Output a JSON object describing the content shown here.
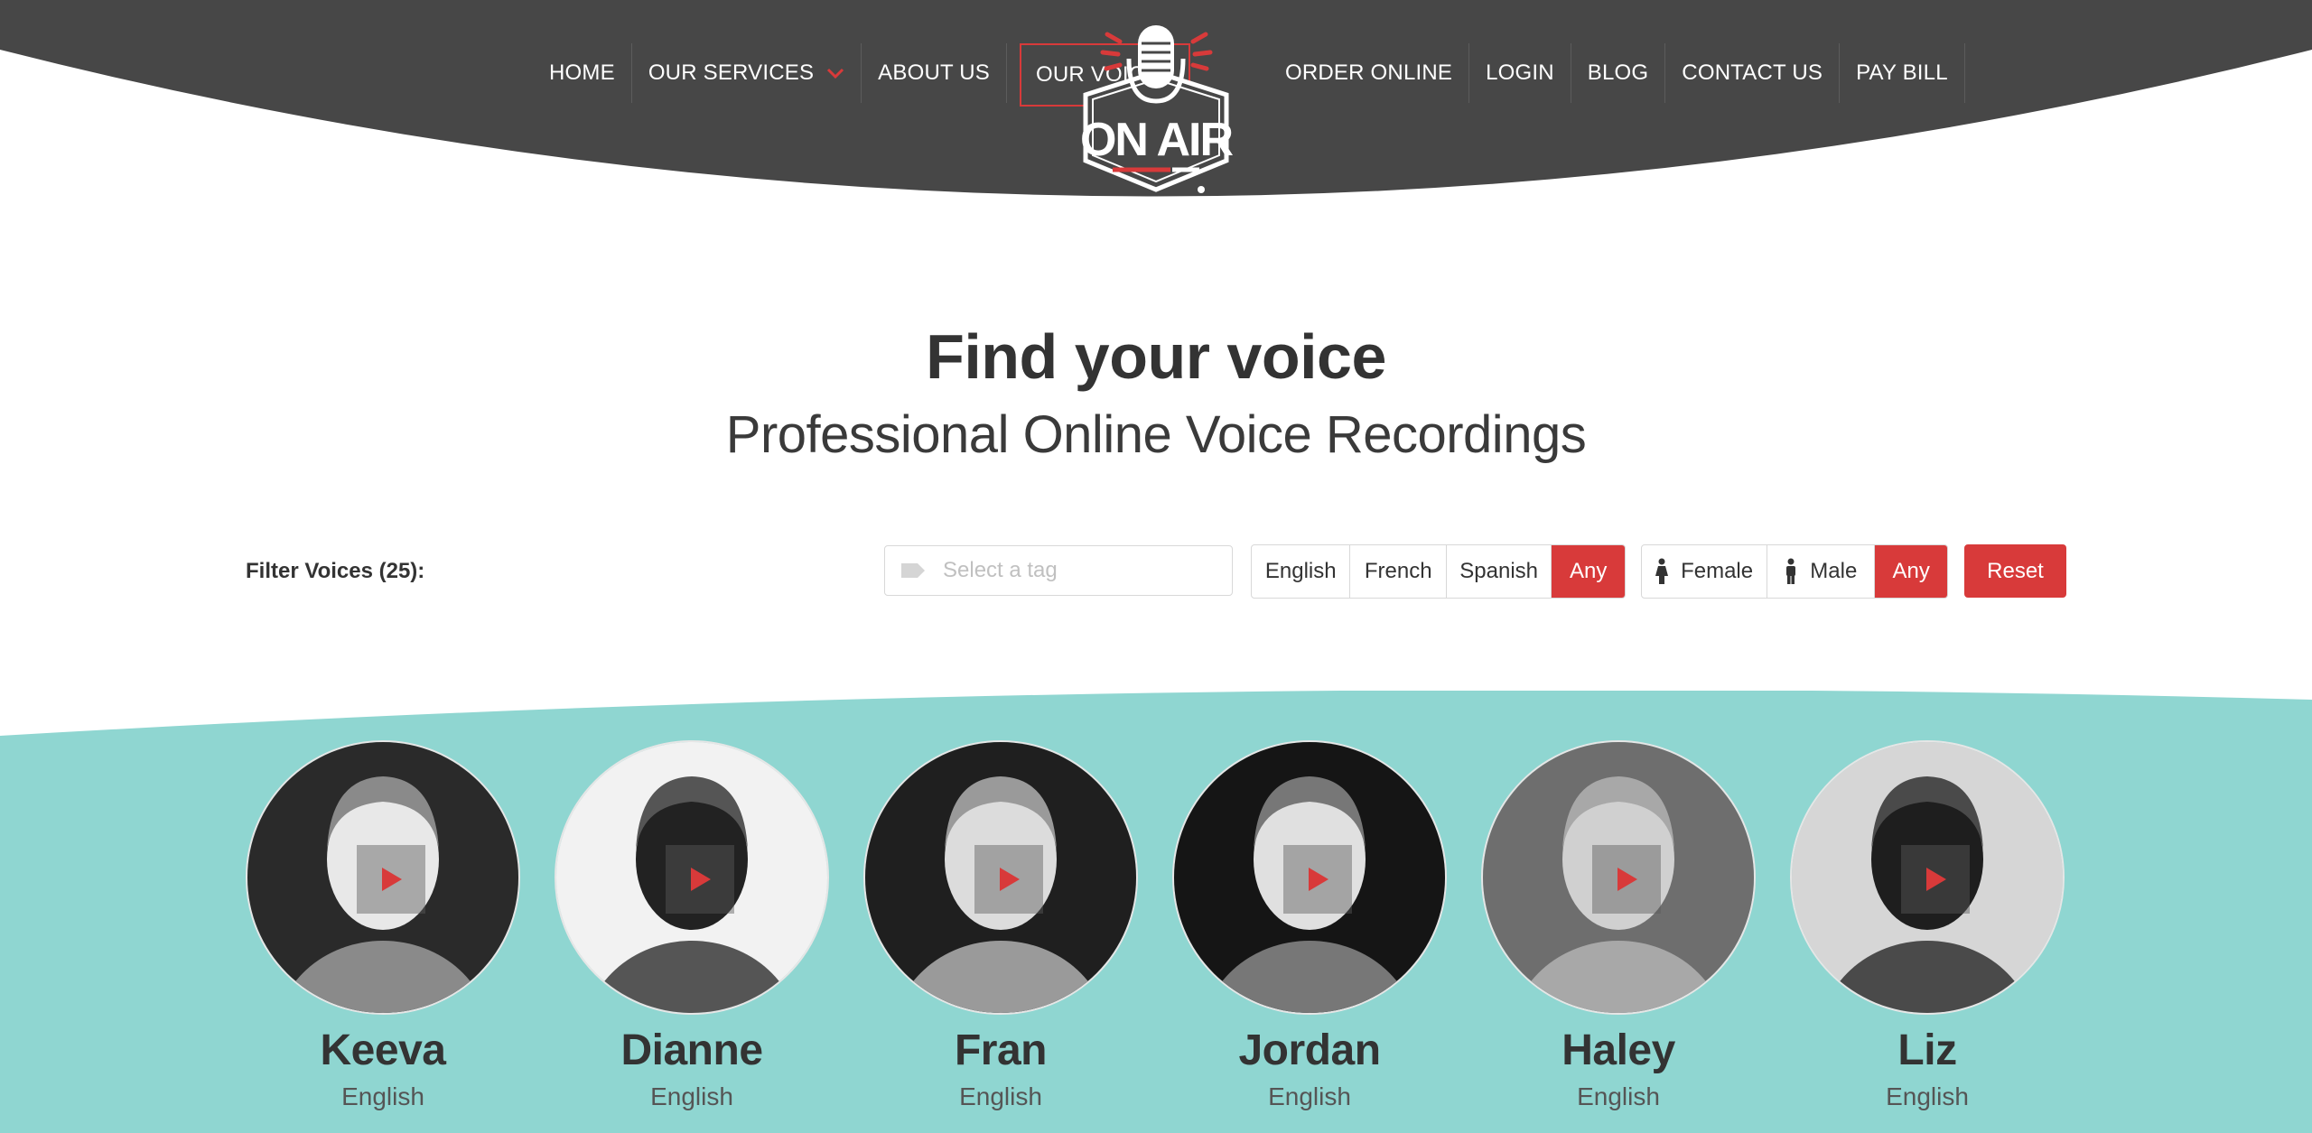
{
  "colors": {
    "header": "#474747",
    "accent": "#d83a3a",
    "teal": "#8fd6d1",
    "text": "#333333"
  },
  "nav": {
    "left": [
      {
        "label": "HOME"
      },
      {
        "label": "OUR SERVICES",
        "has_dropdown": true,
        "icon": "chevron-down-icon"
      },
      {
        "label": "ABOUT US"
      },
      {
        "label": "OUR VOICES",
        "active": true
      }
    ],
    "right": [
      {
        "label": "ORDER ONLINE"
      },
      {
        "label": "LOGIN"
      },
      {
        "label": "BLOG"
      },
      {
        "label": "CONTACT US"
      },
      {
        "label": "PAY BILL"
      }
    ]
  },
  "logo": {
    "text": "ON AIR",
    "icon": "microphone-icon"
  },
  "hero": {
    "title": "Find your voice",
    "subtitle": "Professional Online Voice Recordings"
  },
  "filter": {
    "label": "Filter Voices (25):",
    "tag_placeholder": "Select a tag",
    "tag_icon": "tag-icon",
    "languages": [
      {
        "label": "English",
        "selected": false
      },
      {
        "label": "French",
        "selected": false
      },
      {
        "label": "Spanish",
        "selected": false
      },
      {
        "label": "Any",
        "selected": true
      }
    ],
    "genders": [
      {
        "label": "Female",
        "icon": "female-icon",
        "selected": false
      },
      {
        "label": "Male",
        "icon": "male-icon",
        "selected": false
      },
      {
        "label": "Any",
        "selected": true
      }
    ],
    "reset_label": "Reset"
  },
  "voices": [
    {
      "name": "Keeva",
      "language": "English",
      "icon": "play-icon"
    },
    {
      "name": "Dianne",
      "language": "English",
      "icon": "play-icon"
    },
    {
      "name": "Fran",
      "language": "English",
      "icon": "play-icon"
    },
    {
      "name": "Jordan",
      "language": "English",
      "icon": "play-icon"
    },
    {
      "name": "Haley",
      "language": "English",
      "icon": "play-icon"
    },
    {
      "name": "Liz",
      "language": "English",
      "icon": "play-icon"
    }
  ]
}
